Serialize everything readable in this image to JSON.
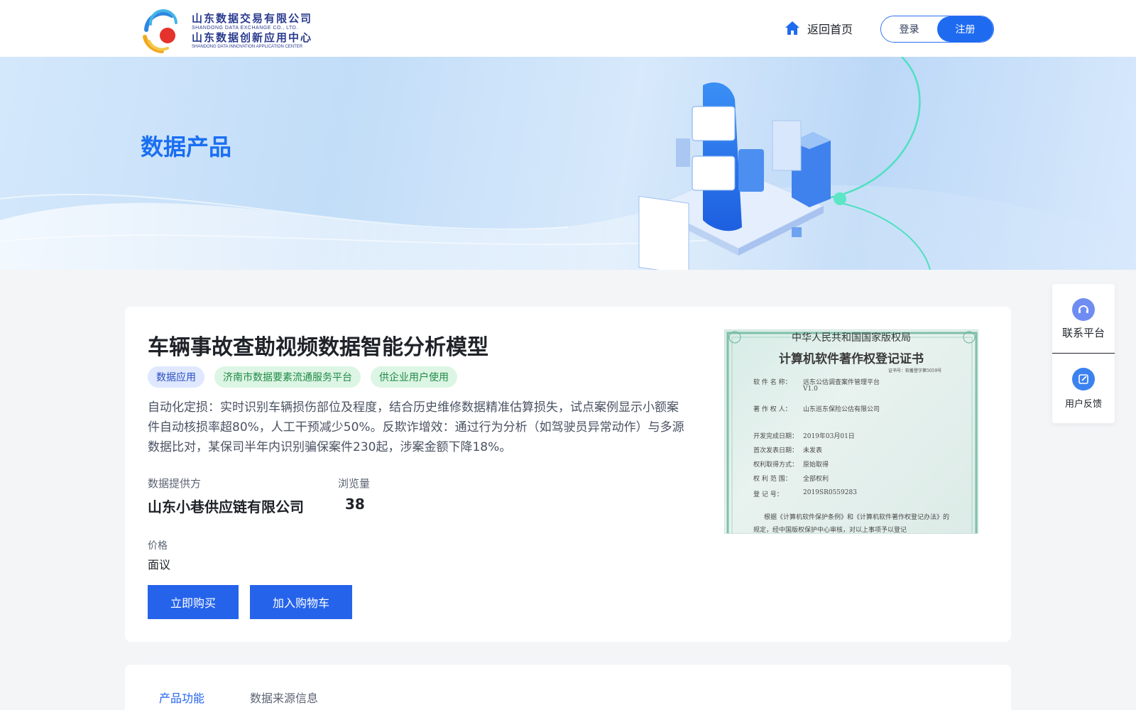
{
  "header": {
    "logo": {
      "cn_line1": "山东数据交易有限公司",
      "en_line1": "SHANDONG DATA EXCHANGE CO., LTD.",
      "cn_line2": "山东数据创新应用中心",
      "en_line2": "SHANDONG DATA INNOVATION APPLICATION CENTER"
    },
    "home_label": "返回首页",
    "home_icon": "home-icon",
    "login_label": "登录",
    "register_label": "注册"
  },
  "banner": {
    "title": "数据产品"
  },
  "product": {
    "title": "车辆事故查勘视频数据智能分析模型",
    "tags": [
      {
        "label": "数据应用",
        "color": "blue"
      },
      {
        "label": "济南市数据要素流通服务平台",
        "color": "green"
      },
      {
        "label": "供企业用户使用",
        "color": "green"
      }
    ],
    "description": "自动化定损：实时识别车辆损伤部位及程度，结合历史维修数据精准估算损失，试点案例显示小额案件自动核损率超80%，人工干预减少50%。反欺诈增效：通过行为分析（如驾驶员异常动作）与多源数据比对，某保司半年内识别骗保案件230起，涉案金额下降18%。",
    "provider_label": "数据提供方",
    "provider_value": "山东小巷供应链有限公司",
    "views_label": "浏览量",
    "views_value": "38",
    "price_label": "价格",
    "price_value": "面议",
    "buy_now": "立即购买",
    "add_cart": "加入购物车"
  },
  "certificate": {
    "authority": "中华人民共和国国家版权局",
    "title": "计算机软件著作权登记证书",
    "cert_no": "证书号：软著登字第5059号",
    "software_name_label": "软 件 名 称：",
    "software_name": "远东公估调查案件管理平台",
    "version": "V1.0",
    "owner_label": "著 作 权 人：",
    "owner": "山东巡东保险公估有限公司",
    "dev_date_label": "开发完成日期：",
    "dev_date": "2019年03月01日",
    "publish_label": "首次发表日期：",
    "publish": "未发表",
    "acquire_label": "权利取得方式：",
    "acquire": "原始取得",
    "scope_label": "权 利 范 围：",
    "scope": "全部权利",
    "reg_label": "登  记  号：",
    "reg_no": "2019SR0559283",
    "footer1": "根据《计算机软件保护条例》和《计算机软件著作权登记办法》的",
    "footer2": "规定，经中国版权保护中心审核，对以上事项予以登记"
  },
  "side_panel": {
    "contact_label": "联系平台",
    "contact_icon": "headset-icon",
    "feedback_label": "用户反馈",
    "feedback_icon": "edit-icon"
  },
  "tabs": [
    {
      "label": "产品功能",
      "active": true
    },
    {
      "label": "数据来源信息",
      "active": false
    }
  ],
  "colors": {
    "primary": "#2563eb",
    "banner_title": "#1a6ef2",
    "tag_green_bg": "#ddf5e4",
    "tag_blue_bg": "#dfe8ff"
  }
}
